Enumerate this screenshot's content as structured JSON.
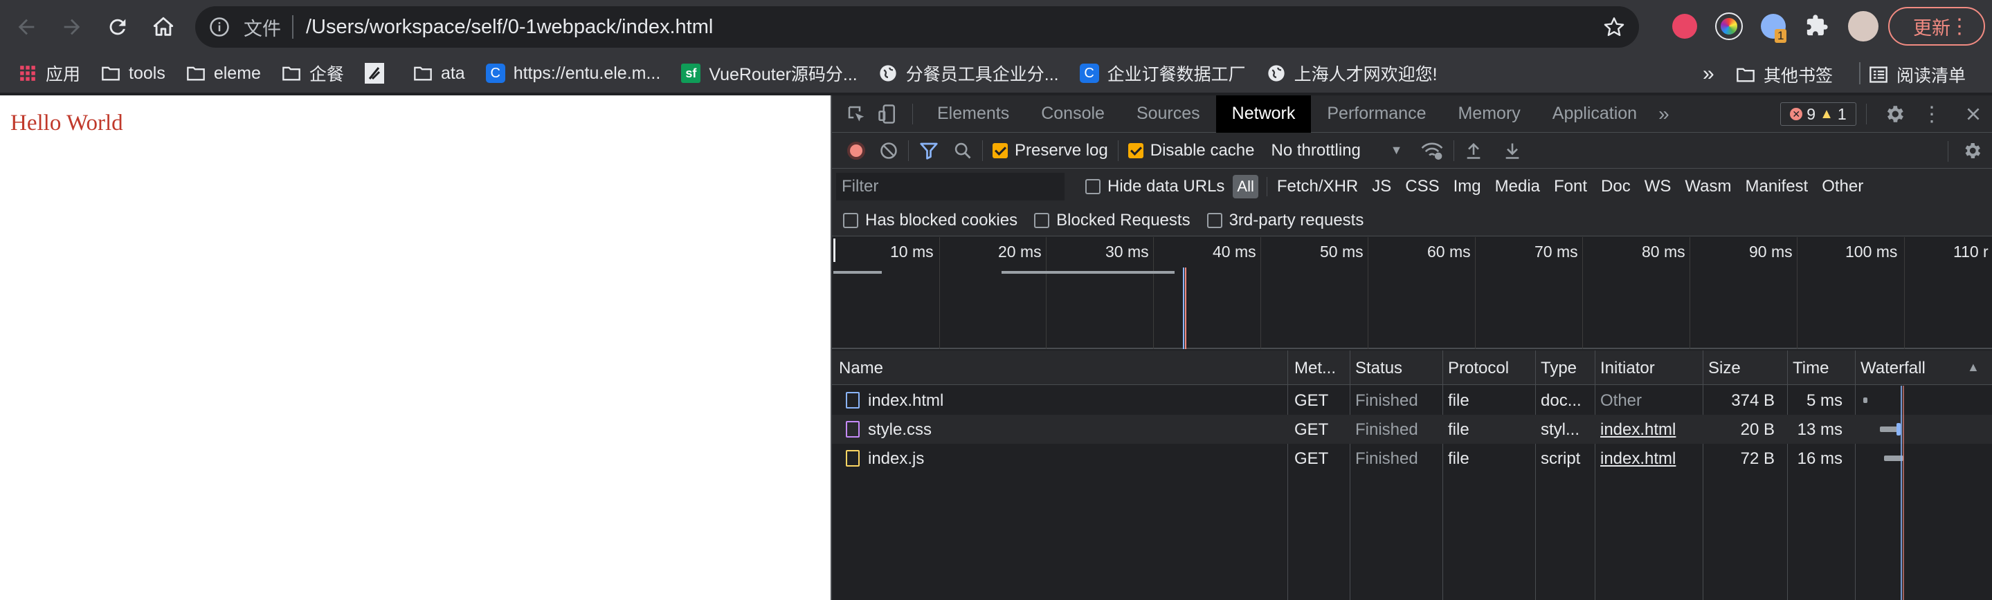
{
  "browser": {
    "url_scheme": "文件",
    "url": "/Users/workspace/self/0-1webpack/index.html",
    "update_label": "更新",
    "extension_badge": "1",
    "bookmarks": [
      {
        "label": "应用",
        "icon": "apps-grid-icon"
      },
      {
        "label": "tools",
        "icon": "folder-icon"
      },
      {
        "label": "eleme",
        "icon": "folder-icon"
      },
      {
        "label": "企餐",
        "icon": "folder-icon"
      },
      {
        "label": "",
        "icon": "logo-icon"
      },
      {
        "label": "ata",
        "icon": "folder-icon"
      },
      {
        "label": "https://entu.ele.m...",
        "icon": "site-icon"
      },
      {
        "label": "VueRouter源码分...",
        "icon": "sf-icon"
      },
      {
        "label": "分餐员工具企业分...",
        "icon": "globe-icon"
      },
      {
        "label": "企业订餐数据工厂",
        "icon": "site-icon"
      },
      {
        "label": "上海人才网欢迎您!",
        "icon": "globe-icon"
      }
    ],
    "bookmarks_overflow": "»",
    "other_bookmarks": "其他书签",
    "reading_list": "阅读清单"
  },
  "page": {
    "hello_text": "Hello World"
  },
  "devtools": {
    "tabs": [
      "Elements",
      "Console",
      "Sources",
      "Network",
      "Performance",
      "Memory",
      "Application"
    ],
    "active_tab": "Network",
    "more_tabs": "»",
    "error_count": "9",
    "warning_count": "1",
    "toolbar": {
      "preserve_log": "Preserve log",
      "disable_cache": "Disable cache",
      "throttling": "No throttling"
    },
    "filter": {
      "placeholder": "Filter",
      "hide_data_urls": "Hide data URLs",
      "types": [
        "All",
        "Fetch/XHR",
        "JS",
        "CSS",
        "Img",
        "Media",
        "Font",
        "Doc",
        "WS",
        "Wasm",
        "Manifest",
        "Other"
      ]
    },
    "filter_row2": {
      "has_blocked_cookies": "Has blocked cookies",
      "blocked_requests": "Blocked Requests",
      "third_party": "3rd-party requests"
    },
    "overview_ticks": [
      "10 ms",
      "20 ms",
      "30 ms",
      "40 ms",
      "50 ms",
      "60 ms",
      "70 ms",
      "80 ms",
      "90 ms",
      "100 ms",
      "110 r"
    ],
    "table": {
      "headers": [
        "Name",
        "Met...",
        "Status",
        "Protocol",
        "Type",
        "Initiator",
        "Size",
        "Time",
        "Waterfall"
      ],
      "rows": [
        {
          "name": "index.html",
          "method": "GET",
          "status": "Finished",
          "protocol": "file",
          "type": "doc...",
          "initiator": "Other",
          "size": "374 B",
          "time": "5 ms",
          "icon": "document-icon",
          "icon_color": "#8ab4f8"
        },
        {
          "name": "style.css",
          "method": "GET",
          "status": "Finished",
          "protocol": "file",
          "type": "styl...",
          "initiator": "index.html",
          "size": "20 B",
          "time": "13 ms",
          "icon": "stylesheet-icon",
          "icon_color": "#c58af9"
        },
        {
          "name": "index.js",
          "method": "GET",
          "status": "Finished",
          "protocol": "file",
          "type": "script",
          "initiator": "index.html",
          "size": "72 B",
          "time": "16 ms",
          "icon": "script-icon",
          "icon_color": "#fdd663"
        }
      ]
    }
  }
}
